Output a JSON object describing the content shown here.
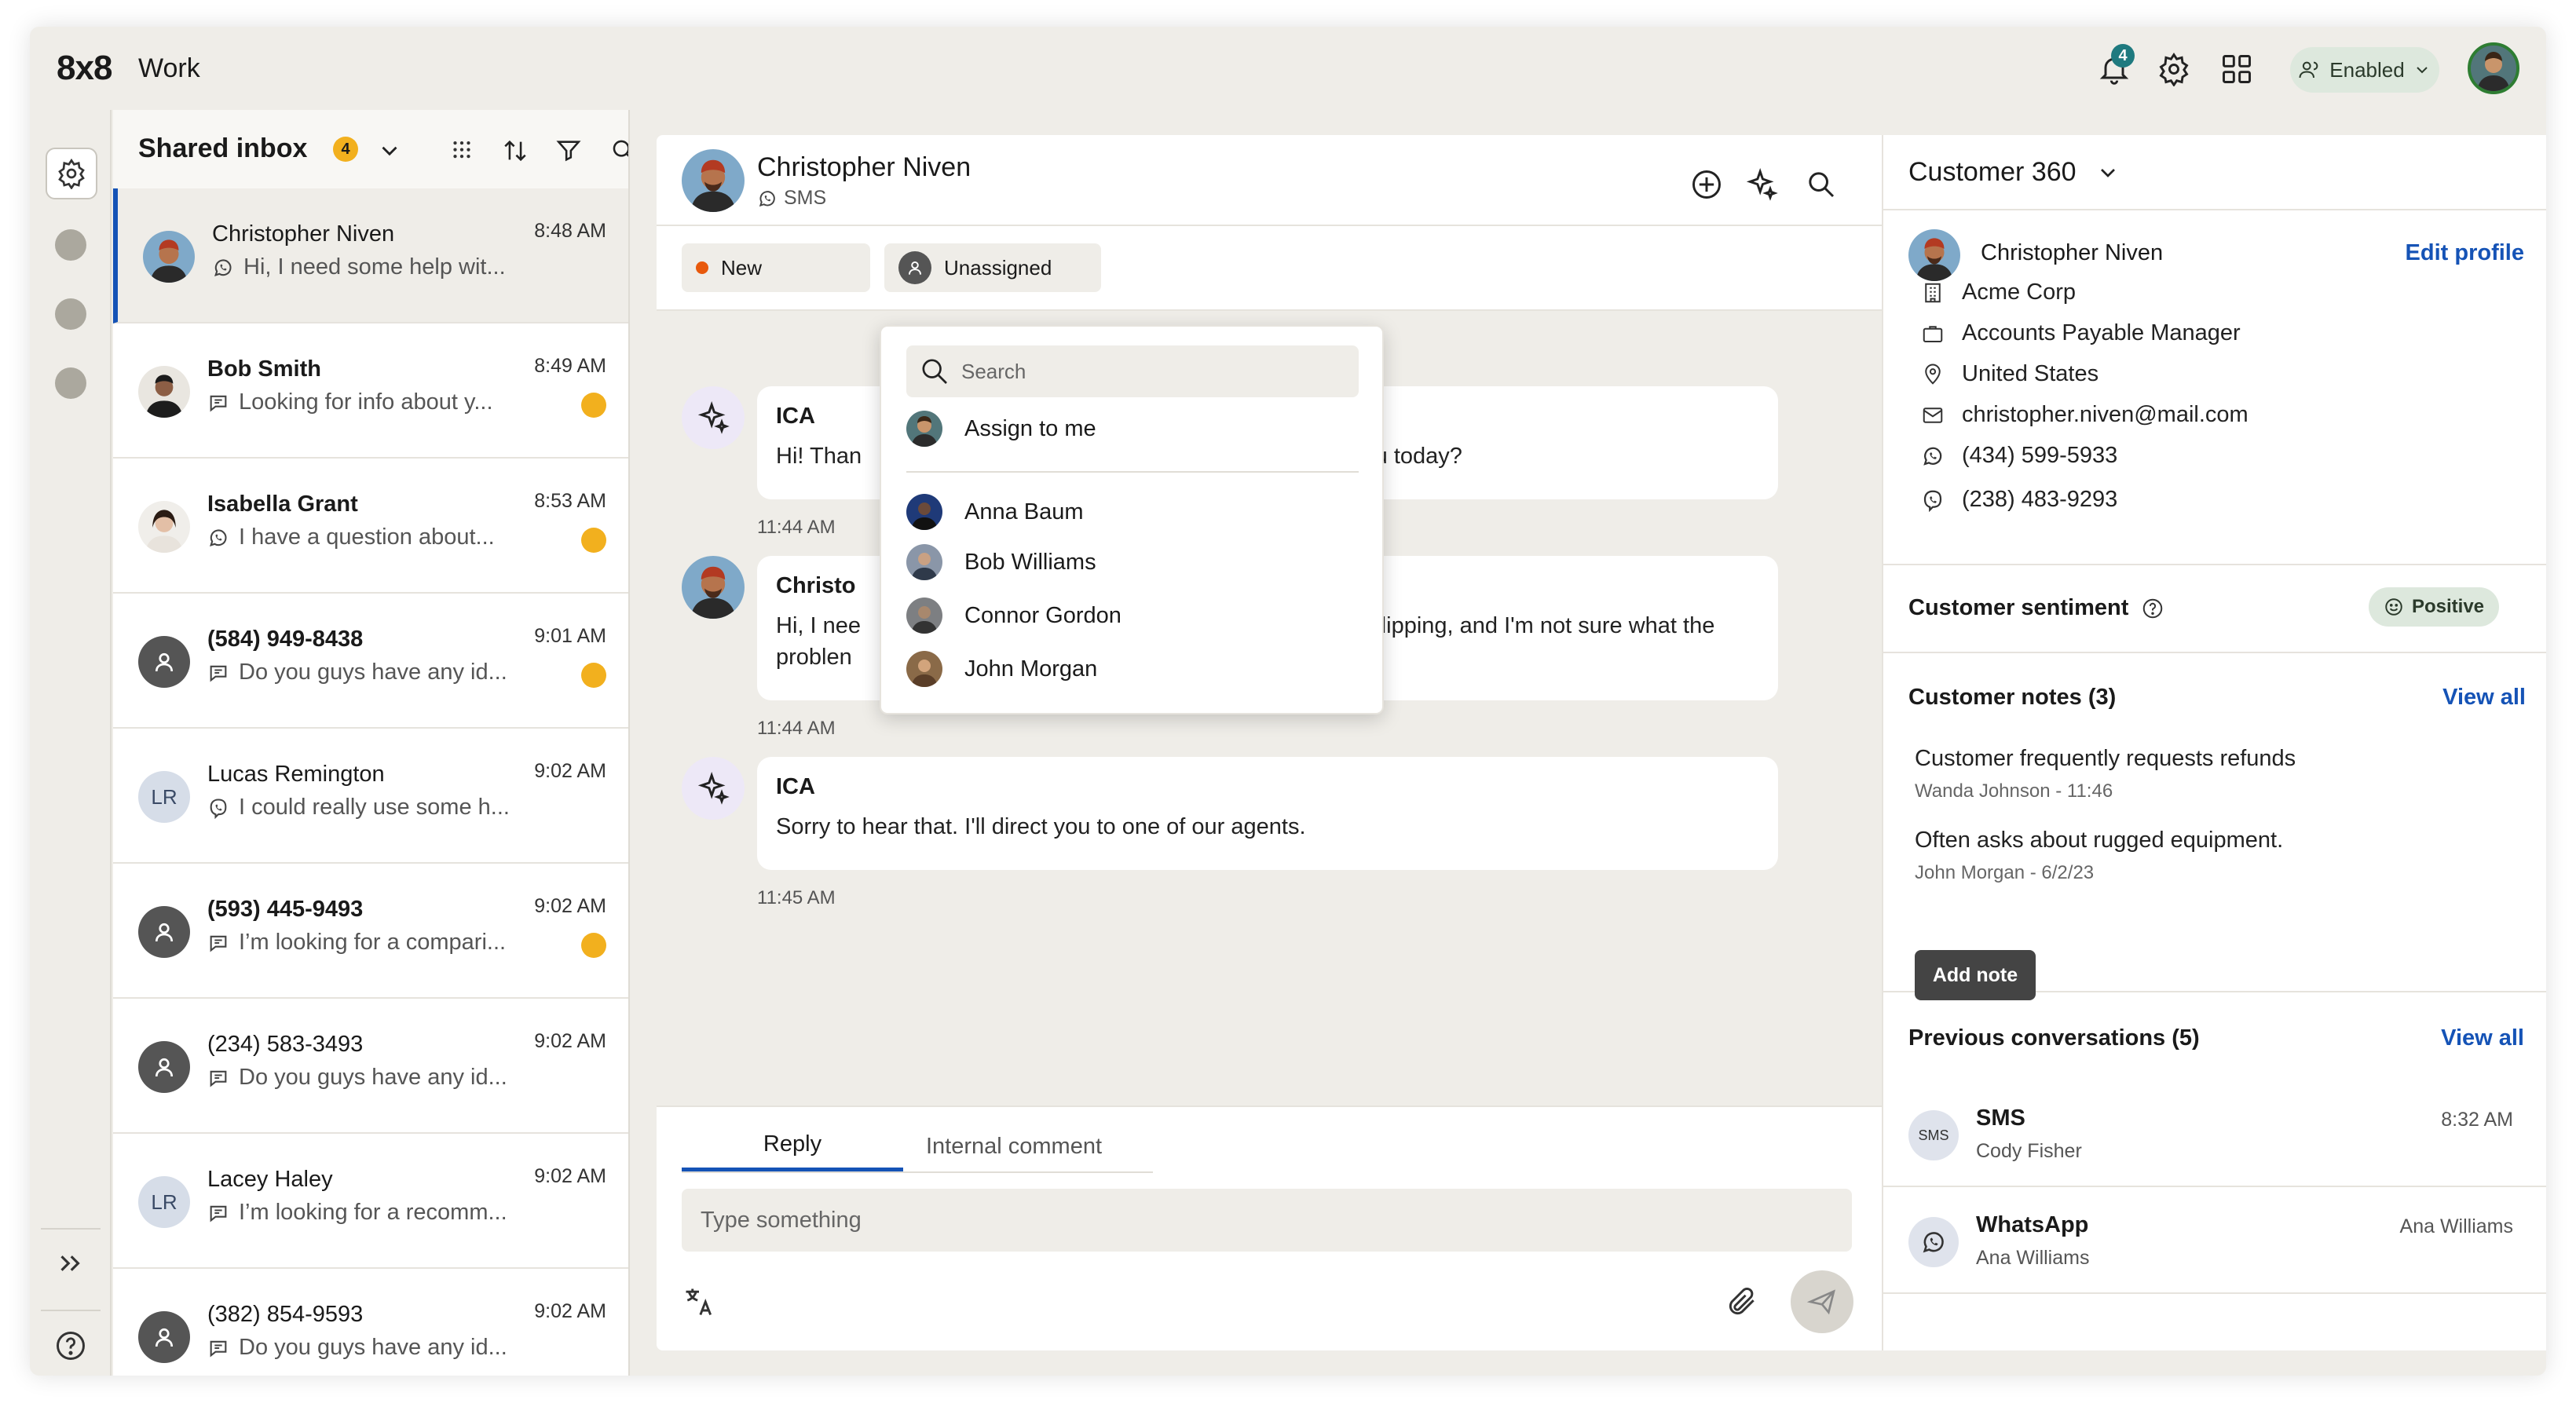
{
  "app": {
    "logo": "8x8",
    "title": "Work"
  },
  "topbar": {
    "notification_count": "4",
    "status_label": "Enabled"
  },
  "inbox": {
    "title": "Shared inbox",
    "badge_count": "4",
    "conversations": [
      {
        "name": "Christopher Niven",
        "preview": "Hi, I need some help wit...",
        "time": "8:48 AM",
        "channel": "whatsapp-icon",
        "unread": false,
        "bold": false,
        "avatar": "photo"
      },
      {
        "name": "Bob Smith",
        "preview": "Looking for info about y...",
        "time": "8:49 AM",
        "channel": "chat-icon",
        "unread": true,
        "bold": true,
        "avatar": "photo"
      },
      {
        "name": "Isabella Grant",
        "preview": "I have a question about...",
        "time": "8:53 AM",
        "channel": "whatsapp-icon",
        "unread": true,
        "bold": true,
        "avatar": "photo"
      },
      {
        "name": "(584) 949-8438",
        "preview": "Do you guys have any id...",
        "time": "9:01 AM",
        "channel": "chat-icon",
        "unread": true,
        "bold": true,
        "avatar": "person"
      },
      {
        "name": "Lucas Remington",
        "preview": "I could really use some h...",
        "time": "9:02 AM",
        "channel": "viber-icon",
        "unread": false,
        "bold": false,
        "avatar": "LR"
      },
      {
        "name": "(593) 445-9493",
        "preview": "I’m looking for a compari...",
        "time": "9:02 AM",
        "channel": "chat-icon",
        "unread": true,
        "bold": true,
        "avatar": "person"
      },
      {
        "name": "(234) 583-3493",
        "preview": "Do you guys have any id...",
        "time": "9:02 AM",
        "channel": "chat-icon",
        "unread": false,
        "bold": false,
        "avatar": "person"
      },
      {
        "name": "Lacey Haley",
        "preview": "I’m looking for a recomm...",
        "time": "9:02 AM",
        "channel": "chat-icon",
        "unread": false,
        "bold": false,
        "avatar": "LR"
      },
      {
        "name": "(382) 854-9593",
        "preview": "Do you guys have any id...",
        "time": "9:02 AM",
        "channel": "chat-icon",
        "unread": false,
        "bold": false,
        "avatar": "person"
      }
    ]
  },
  "chat": {
    "contact_name": "Christopher Niven",
    "channel": "SMS",
    "status": "New",
    "assignee": "Unassigned",
    "messages": [
      {
        "author": "ICA",
        "text_left": "Hi! Than",
        "text_right": "you today?",
        "time": "11:44 AM"
      },
      {
        "author": "Christo",
        "text_left_1": "Hi, I nee",
        "text_right_1": "e slipping, and I'm not sure what the",
        "text_left_2": "problen",
        "time": "11:44 AM"
      },
      {
        "author": "ICA",
        "text": "Sorry to hear that. I'll direct you to one of our agents.",
        "time": "11:45 AM"
      }
    ],
    "composer": {
      "tab_reply": "Reply",
      "tab_internal": "Internal comment",
      "placeholder": "Type something"
    }
  },
  "assign_dropdown": {
    "search_placeholder": "Search",
    "assign_to_me": "Assign to me",
    "agents": [
      "Anna Baum",
      "Bob Williams",
      "Connor Gordon",
      "John Morgan"
    ]
  },
  "customer360": {
    "title": "Customer 360",
    "profile": {
      "name": "Christopher Niven",
      "edit_label": "Edit profile",
      "company": "Acme Corp",
      "job_title": "Accounts Payable Manager",
      "country": "United States",
      "email": "christopher.niven@mail.com",
      "phone_whatsapp": "(434) 599-5933",
      "phone_viber": "(238) 483-9293"
    },
    "sentiment": {
      "label": "Customer sentiment",
      "value": "Positive"
    },
    "notes": {
      "title": "Customer notes (3)",
      "view_all": "View all",
      "items": [
        {
          "text": "Customer frequently requests refunds",
          "meta": "Wanda Johnson - 11:46"
        },
        {
          "text": "Often asks about rugged equipment.",
          "meta": "John Morgan - 6/2/23"
        }
      ],
      "add_label": "Add note"
    },
    "previous": {
      "title": "Previous conversations (5)",
      "view_all": "View all",
      "items": [
        {
          "icon": "SMS",
          "channel": "SMS",
          "contact": "Cody Fisher",
          "right": "8:32 AM"
        },
        {
          "icon": "whatsapp-icon",
          "channel": "WhatsApp",
          "contact": "Ana Williams",
          "right": "Ana Williams"
        }
      ]
    }
  },
  "colors": {
    "accent": "#1553b6",
    "badge": "#f2b01e",
    "teal": "#1f7a7f",
    "status_new": "#e8590c"
  }
}
